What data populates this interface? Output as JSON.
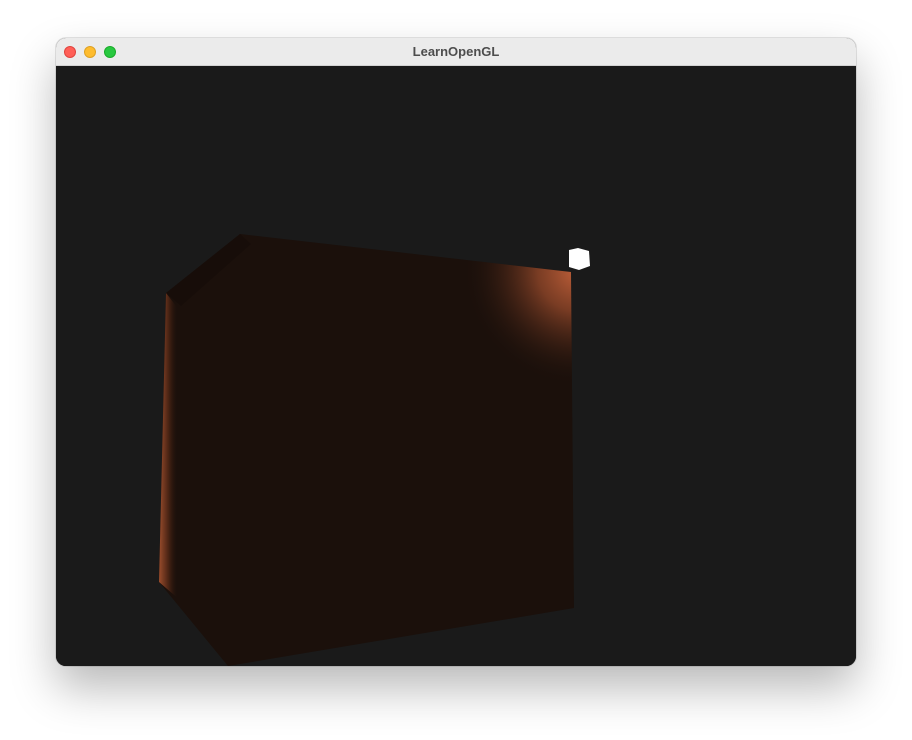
{
  "window": {
    "title": "LearnOpenGL"
  },
  "controls": {
    "close": "close-button",
    "minimize": "minimize-button",
    "zoom": "zoom-button"
  },
  "scene": {
    "clear_color": "#1a1a1a",
    "cube_base_color": "#1b100b",
    "highlight_color": "#b85a36",
    "light_color": "#ffffff"
  }
}
